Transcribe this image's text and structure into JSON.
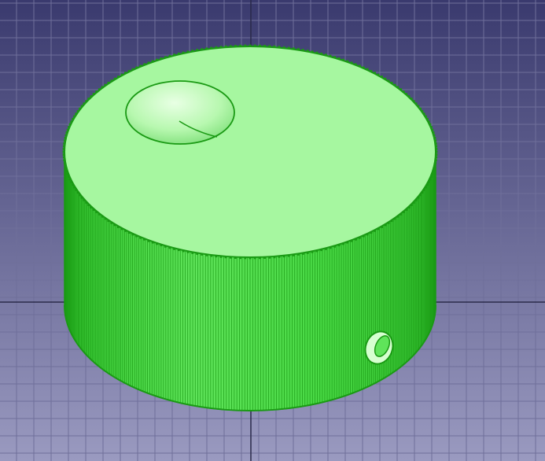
{
  "viewport": {
    "background_top": "#3a3a6e",
    "background_bottom": "#9a9ac0",
    "grid_color": "#6f6f9a",
    "axis_color": "#2a2a4a"
  },
  "model": {
    "object": "knurled-knob",
    "color_face": "#a6f7a0",
    "color_side": "#3ed63a",
    "color_edge": "#1a9a14",
    "color_highlight": "#d6ffd0",
    "state": "selected"
  }
}
